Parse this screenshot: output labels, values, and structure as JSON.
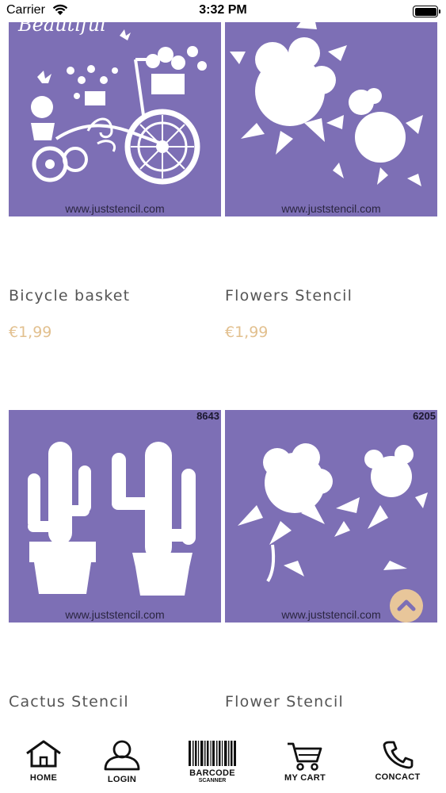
{
  "status_bar": {
    "carrier": "Carrier",
    "time": "3:32 PM"
  },
  "products": [
    {
      "title": "Bicycle basket",
      "price": "€1,99",
      "watermark": "www.juststencil.com",
      "script_text": "Beautiful",
      "code": ""
    },
    {
      "title": "Flowers Stencil",
      "price": "€1,99",
      "watermark": "www.juststencil.com",
      "code": ""
    },
    {
      "title": "Cactus Stencil",
      "price": "",
      "watermark": "www.juststencil.com",
      "code": "8643"
    },
    {
      "title": "Flower Stencil",
      "price": "",
      "watermark": "www.juststencil.com",
      "code": "6205"
    }
  ],
  "tab_bar": {
    "items": [
      {
        "label": "HOME",
        "icon": "home-icon"
      },
      {
        "label": "LOGIN",
        "icon": "user-icon"
      },
      {
        "label": "BARCODE",
        "sub": "SCANNER",
        "icon": "barcode-icon"
      },
      {
        "label": "MY CART",
        "icon": "cart-icon"
      },
      {
        "label": "CONCACT",
        "icon": "phone-icon"
      }
    ]
  },
  "colors": {
    "stencil_bg": "#7d6fb5",
    "price": "#e2c08f",
    "scroll_button": "#e8c69a"
  }
}
